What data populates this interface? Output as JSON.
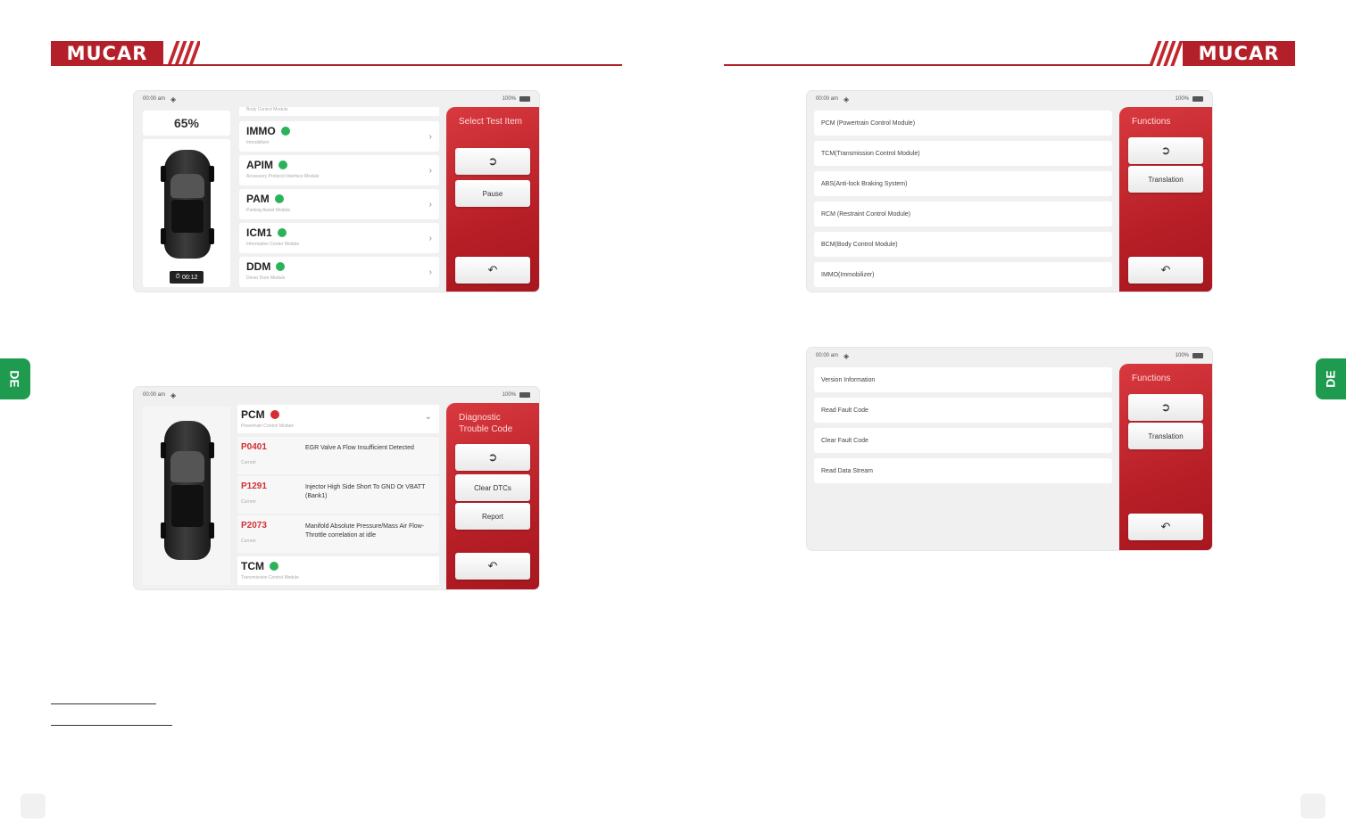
{
  "header": {
    "logo_text": "MUCAR",
    "brand_color": "#b4202a"
  },
  "lang_tab": "DE",
  "shot1": {
    "status_time": "00:00 am",
    "status_battery": "100%",
    "percent": "65%",
    "timer": "00:12",
    "side_title": "Select Test Item",
    "pause_label": "Pause",
    "top_cut_label": "Body Control Module",
    "modules": [
      {
        "name": "IMMO",
        "sub": "Immobilizer"
      },
      {
        "name": "APIM",
        "sub": "Accessory Protocol Interface Module"
      },
      {
        "name": "PAM",
        "sub": "Parking Assist Module"
      },
      {
        "name": "ICM1",
        "sub": "Information Center Module"
      },
      {
        "name": "DDM",
        "sub": "Driver Door Module"
      }
    ]
  },
  "shot2": {
    "status_time": "00:00 am",
    "status_battery": "100%",
    "side_title": "Functions",
    "translation_label": "Translation",
    "items": [
      "PCM (Powertrain Control Module)",
      "TCM(Transmission Control Module)",
      "ABS(Anti-lock Braking System)",
      "RCM (Restraint Control Module)",
      "BCM(Body Control Module)",
      "IMMO(Immobilizer)"
    ]
  },
  "shot3": {
    "status_time": "00:00 am",
    "status_battery": "100%",
    "side_title": "Diagnostic Trouble Code",
    "clear_label": "Clear DTCs",
    "report_label": "Report",
    "pcm_name": "PCM",
    "pcm_sub": "Powertrain Control Module",
    "tcm_name": "TCM",
    "tcm_sub": "Transmission Control Module",
    "dtcs": [
      {
        "code": "P0401",
        "status": "Current",
        "desc": "EGR Valve A Flow Insufficient Detected"
      },
      {
        "code": "P1291",
        "status": "Current",
        "desc": "Injector High Side Short To GND Or VBATT (Bank1)"
      },
      {
        "code": "P2073",
        "status": "Current",
        "desc": "Manifold Absolute Pressure/Mass Air Flow-Throttle correlation at idle"
      }
    ]
  },
  "shot4": {
    "status_time": "00:00 am",
    "status_battery": "100%",
    "side_title": "Functions",
    "translation_label": "Translation",
    "items": [
      "Version Information",
      "Read Fault Code",
      "Clear Fault Code",
      "Read Data Stream"
    ]
  }
}
